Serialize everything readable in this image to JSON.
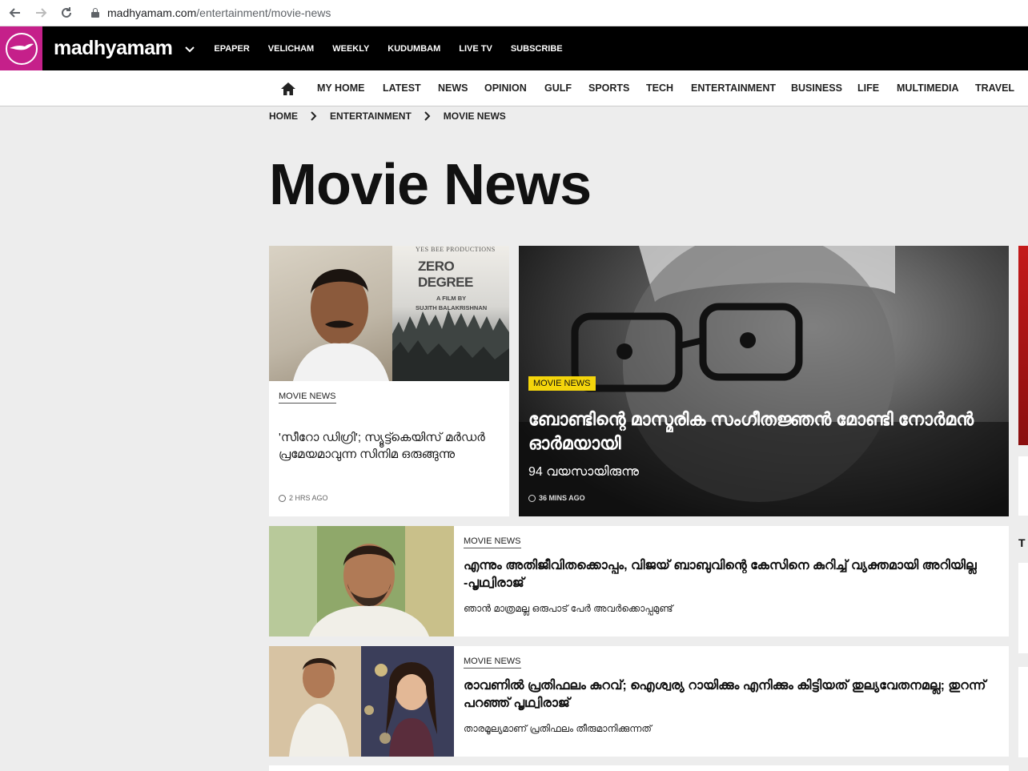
{
  "browser": {
    "url_domain": "madhyamam.com",
    "url_path": "/entertainment/movie-news"
  },
  "topbar": {
    "brand": "madhyamam",
    "brand_color": "#c5208a",
    "links": [
      "EPAPER",
      "VELICHAM",
      "WEEKLY",
      "KUDUMBAM",
      "LIVE TV",
      "SUBSCRIBE"
    ]
  },
  "section_nav": [
    "MY HOME",
    "LATEST",
    "NEWS",
    "OPINION",
    "GULF",
    "SPORTS",
    "TECH",
    "ENTERTAINMENT",
    "BUSINESS",
    "LIFE",
    "MULTIMEDIA",
    "TRAVEL"
  ],
  "breadcrumb": [
    "HOME",
    "ENTERTAINMENT",
    "MOVIE NEWS"
  ],
  "page_title": "Movie News",
  "card1": {
    "label": "MOVIE NEWS",
    "headline": "'സീറോ ഡിഗ്രി'; സ്യൂട്ട്കെയിസ് മർഡർ പ്രമേയമാവുന്ന സിനിമ ഒരുങ്ങുന്നു",
    "time": "2 HRS AGO",
    "poster": {
      "production": "YES BEE PRODUCTIONS",
      "title": "ZERO DEGREE",
      "credit_line1": "A FILM BY",
      "credit_line2": "SUJITH BALAKRISHNAN"
    }
  },
  "hero": {
    "label": "MOVIE NEWS",
    "label_color": "#f4d50b",
    "headline": "ബോണ്ടിന്റെ മാസ്മരിക സംഗീതജ്ഞൻ മോണ്ടി നോർമൻ ഓർമയായി",
    "sub": "94 വയസായിരുന്നു",
    "time": "36 MINS AGO"
  },
  "list": [
    {
      "label": "MOVIE NEWS",
      "headline": "എന്നും അതിജീവിതക്കൊപ്പം, വിജയ് ബാബുവിന്റെ കേസിനെ കുറിച്ച് വ്യക്തമായി അറിയില്ല -പൃഥ്വിരാജ്",
      "sub": "ഞാൻ മാത്രമല്ല ഒരുപാട് പേർ അവർക്കൊപ്പമുണ്ട്"
    },
    {
      "label": "MOVIE NEWS",
      "headline": "രാവണിൽ പ്രതിഫലം കുറവ്; ഐശ്വര്യ റായിക്കും എനിക്കും കിട്ടിയത് തുല്യവേതനമല്ല; തുറന്ന് പറഞ്ഞ് പൃഥ്വിരാജ്",
      "sub": "താരമൂല്യമാണ് പ്രതിഫലം തീരുമാനിക്കുന്നത്"
    }
  ],
  "edge_text": "T"
}
